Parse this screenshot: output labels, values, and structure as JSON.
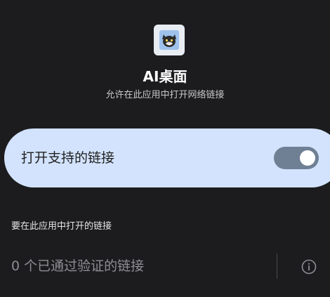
{
  "app": {
    "name": "AI桌面",
    "description": "允许在此应用中打开网络链接"
  },
  "toggle": {
    "label": "打开支持的链接",
    "checked": true,
    "accent_color": "#d3e3fd",
    "track_color": "#6f7f94"
  },
  "links_section": {
    "title": "要在此应用中打开的链接",
    "verified_text": "0 个已通过验证的链接",
    "info_icon": "info-icon"
  }
}
